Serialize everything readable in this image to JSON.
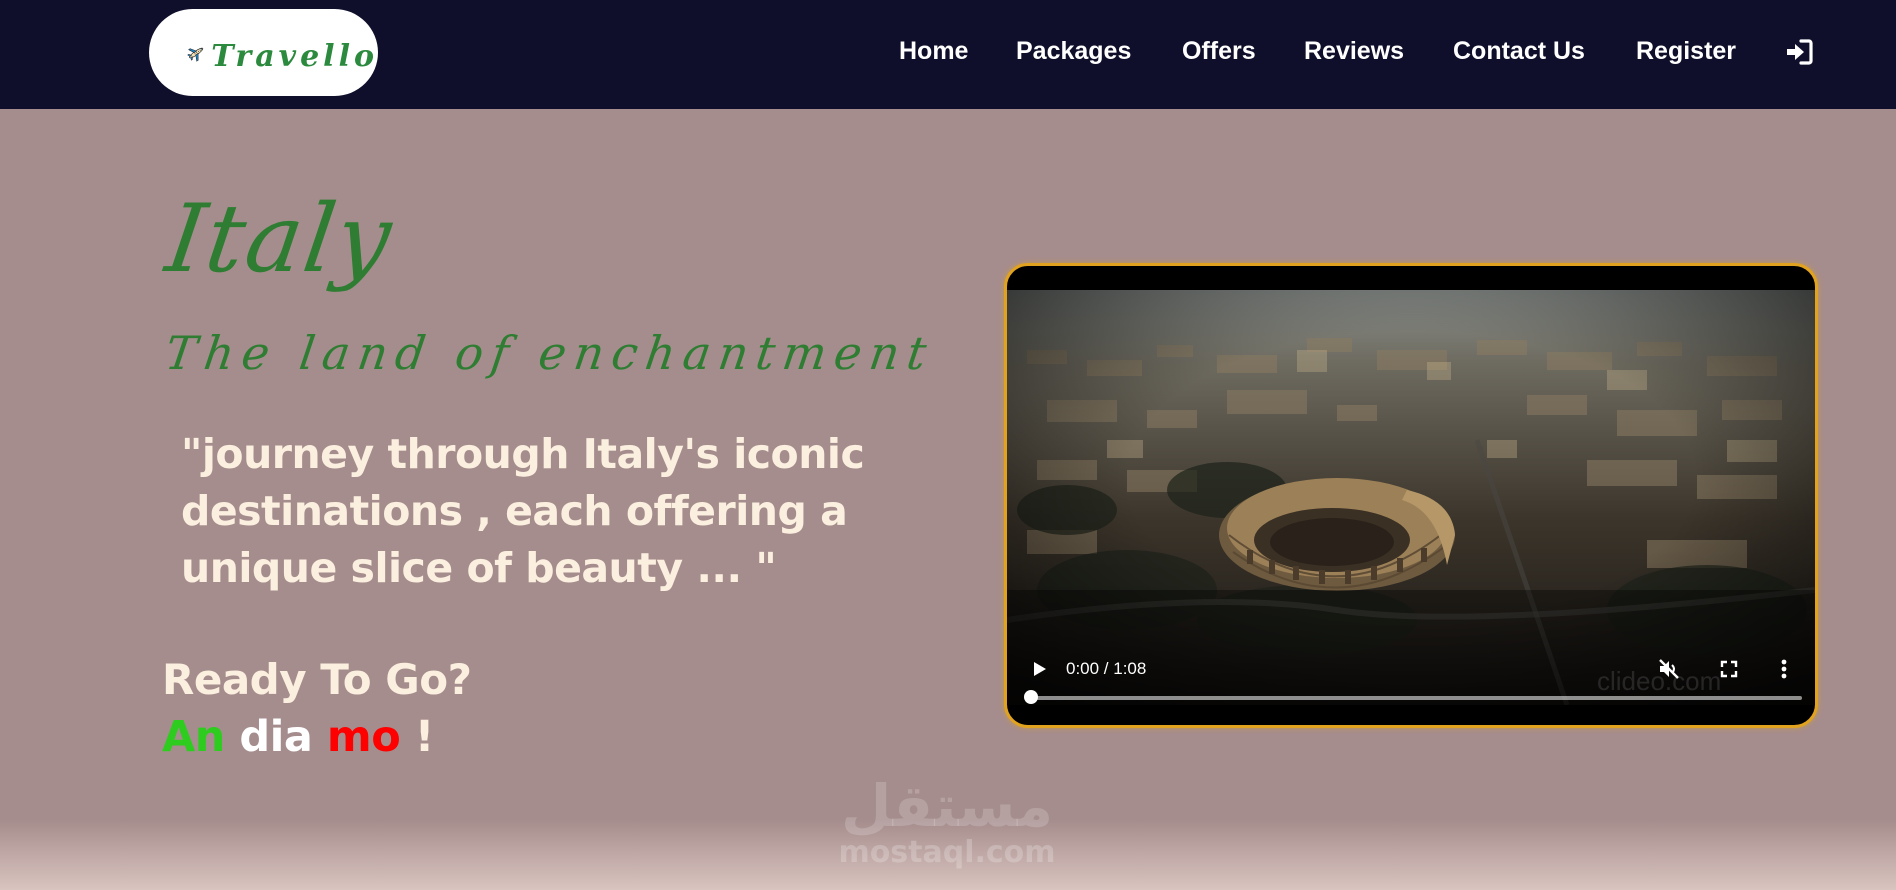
{
  "nav": {
    "logo_text": "Travello",
    "links": [
      "Home",
      "Packages",
      "Offers",
      "Reviews",
      "Contact Us",
      "Register"
    ],
    "login_icon": "sign-in-icon"
  },
  "hero": {
    "title": "Italy",
    "subtitle": "The land of enchantment",
    "quote_lines": [
      "\"journey through Italy's iconic",
      "destinations , each offering a",
      "unique slice of beauty ... \""
    ],
    "ready": "Ready To Go?",
    "andiamo": {
      "part1": "An",
      "part2": "dia",
      "part3": "mo",
      "bang": "!"
    }
  },
  "video": {
    "time": "0:00 / 1:08",
    "progress": 0,
    "watermark": "clideo.com",
    "controls": [
      "play-icon",
      "mute-icon",
      "fullscreen-icon",
      "more-options-icon"
    ]
  },
  "watermark": {
    "arabic": "مستقل",
    "latin": "mostaql.com"
  },
  "colors": {
    "navbar": "#0f0f2b",
    "page_bg": "#a68d8d",
    "title_green": "#2e7d32",
    "cream": "#fbefdf",
    "video_border": "#e0a21f",
    "italy_green": "#2ecc1f",
    "italy_red": "#ff0000"
  }
}
